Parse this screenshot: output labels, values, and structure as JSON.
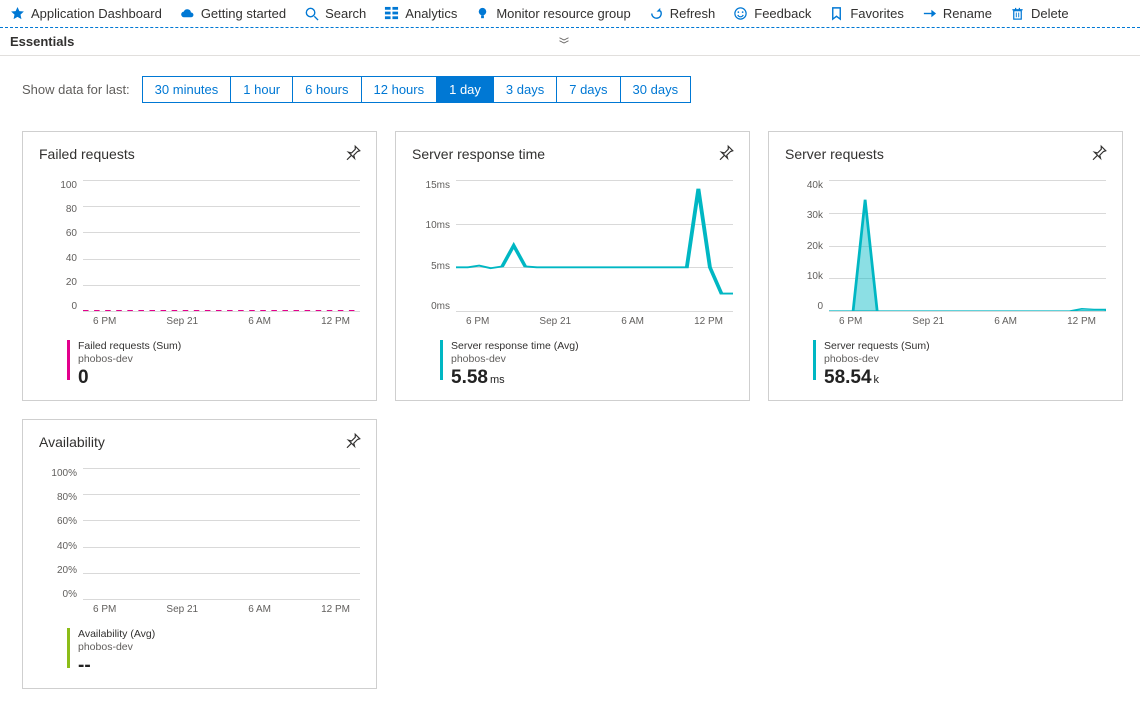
{
  "toolbar": [
    {
      "id": "app-dashboard",
      "label": "Application Dashboard",
      "icon": "star"
    },
    {
      "id": "getting-started",
      "label": "Getting started",
      "icon": "cloud"
    },
    {
      "id": "search",
      "label": "Search",
      "icon": "search"
    },
    {
      "id": "analytics",
      "label": "Analytics",
      "icon": "grid"
    },
    {
      "id": "monitor",
      "label": "Monitor resource group",
      "icon": "bulb"
    },
    {
      "id": "refresh",
      "label": "Refresh",
      "icon": "refresh"
    },
    {
      "id": "feedback",
      "label": "Feedback",
      "icon": "smile"
    },
    {
      "id": "favorites",
      "label": "Favorites",
      "icon": "bookmark"
    },
    {
      "id": "rename",
      "label": "Rename",
      "icon": "arrow-right"
    },
    {
      "id": "delete",
      "label": "Delete",
      "icon": "trash"
    }
  ],
  "essentials_label": "Essentials",
  "timerange": {
    "label": "Show data for last:",
    "options": [
      "30 minutes",
      "1 hour",
      "6 hours",
      "12 hours",
      "1 day",
      "3 days",
      "7 days",
      "30 days"
    ],
    "selected": "1 day"
  },
  "x_ticks": [
    "6 PM",
    "Sep 21",
    "6 AM",
    "12 PM"
  ],
  "resource": "phobos-dev",
  "cards": {
    "failed_requests": {
      "title": "Failed requests",
      "metric_name": "Failed requests (Sum)",
      "metric_sub": "phobos-dev",
      "metric_value": "0",
      "metric_unit": "",
      "accent": "#e3008c",
      "y_ticks": [
        "100",
        "80",
        "60",
        "40",
        "20",
        "0"
      ]
    },
    "server_response_time": {
      "title": "Server response time",
      "metric_name": "Server response time (Avg)",
      "metric_sub": "phobos-dev",
      "metric_value": "5.58",
      "metric_unit": "ms",
      "accent": "#00b7c3",
      "y_ticks": [
        "15ms",
        "10ms",
        "5ms",
        "0ms"
      ]
    },
    "server_requests": {
      "title": "Server requests",
      "metric_name": "Server requests (Sum)",
      "metric_sub": "phobos-dev",
      "metric_value": "58.54",
      "metric_unit": "k",
      "accent": "#00b7c3",
      "y_ticks": [
        "40k",
        "30k",
        "20k",
        "10k",
        "0"
      ]
    },
    "availability": {
      "title": "Availability",
      "metric_name": "Availability (Avg)",
      "metric_sub": "phobos-dev",
      "metric_value": "--",
      "metric_unit": "",
      "accent": "#8cbd18",
      "y_ticks": [
        "100%",
        "80%",
        "60%",
        "40%",
        "20%",
        "0%"
      ]
    }
  },
  "chart_data": [
    {
      "id": "failed_requests",
      "type": "line",
      "title": "Failed requests",
      "ylabel": "",
      "xlabel": "",
      "ylim": [
        0,
        100
      ],
      "x": [
        "6 PM",
        "Sep 21",
        "6 AM",
        "12 PM"
      ],
      "series": [
        {
          "name": "Failed requests (Sum) – phobos-dev",
          "color": "#e3008c",
          "values": [
            0,
            0,
            0,
            0,
            0,
            0,
            0,
            0,
            0,
            0,
            0,
            0,
            0,
            0,
            0,
            0,
            0,
            0,
            0,
            0,
            0,
            0,
            0,
            0
          ]
        }
      ]
    },
    {
      "id": "server_response_time",
      "type": "line",
      "title": "Server response time",
      "ylabel": "ms",
      "xlabel": "",
      "ylim": [
        0,
        15
      ],
      "x": [
        "6 PM",
        "Sep 21",
        "6 AM",
        "12 PM"
      ],
      "series": [
        {
          "name": "Server response time (Avg) – phobos-dev",
          "color": "#00b7c3",
          "values": [
            5.0,
            5.0,
            5.2,
            4.9,
            5.1,
            7.5,
            5.1,
            5.0,
            5.0,
            5.0,
            5.0,
            5.0,
            5.0,
            5.0,
            5.0,
            5.0,
            5.0,
            5.0,
            5.0,
            5.0,
            5.0,
            14.0,
            5.0,
            2.0,
            2.0
          ]
        }
      ]
    },
    {
      "id": "server_requests",
      "type": "area",
      "title": "Server requests",
      "ylabel": "",
      "xlabel": "",
      "ylim": [
        0,
        40000
      ],
      "x": [
        "6 PM",
        "Sep 21",
        "6 AM",
        "12 PM"
      ],
      "series": [
        {
          "name": "Server requests (Sum) – phobos-dev",
          "color": "#00b7c3",
          "values": [
            0,
            0,
            0,
            34000,
            0,
            0,
            0,
            0,
            0,
            0,
            0,
            0,
            0,
            0,
            0,
            0,
            0,
            0,
            0,
            0,
            0,
            700,
            500,
            500
          ]
        }
      ]
    },
    {
      "id": "availability",
      "type": "line",
      "title": "Availability",
      "ylabel": "%",
      "xlabel": "",
      "ylim": [
        0,
        100
      ],
      "x": [
        "6 PM",
        "Sep 21",
        "6 AM",
        "12 PM"
      ],
      "series": [
        {
          "name": "Availability (Avg) – phobos-dev",
          "color": "#8cbd18",
          "values": []
        }
      ]
    }
  ]
}
